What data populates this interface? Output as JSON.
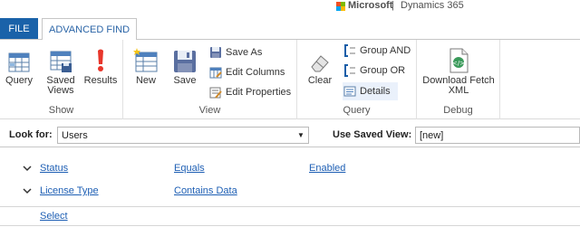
{
  "brand": {
    "company": "Microsoft",
    "separator": "|",
    "product": "Dynamics 365"
  },
  "tabs": {
    "file": "FILE",
    "advanced_find": "ADVANCED FIND"
  },
  "ribbon": {
    "show": {
      "label": "Show",
      "query": "Query",
      "saved_views": "Saved\nViews",
      "results": "Results"
    },
    "view": {
      "label": "View",
      "new": "New",
      "save": "Save",
      "save_as": "Save As",
      "edit_columns": "Edit Columns",
      "edit_properties": "Edit Properties"
    },
    "query": {
      "label": "Query",
      "clear": "Clear",
      "group_and": "Group AND",
      "group_or": "Group OR",
      "details": "Details"
    },
    "debug": {
      "label": "Debug",
      "download_fetch_xml": "Download Fetch\nXML"
    }
  },
  "lookfor": {
    "label": "Look for:",
    "value": "Users",
    "saved_view_label": "Use Saved View:",
    "saved_view_value": "[new]"
  },
  "criteria": [
    {
      "field": "Status",
      "operator": "Equals",
      "value": "Enabled"
    },
    {
      "field": "License Type",
      "operator": "Contains Data",
      "value": ""
    }
  ],
  "select_link": "Select",
  "colors": {
    "accent": "#1a62a9",
    "link": "#1e5fb4"
  }
}
